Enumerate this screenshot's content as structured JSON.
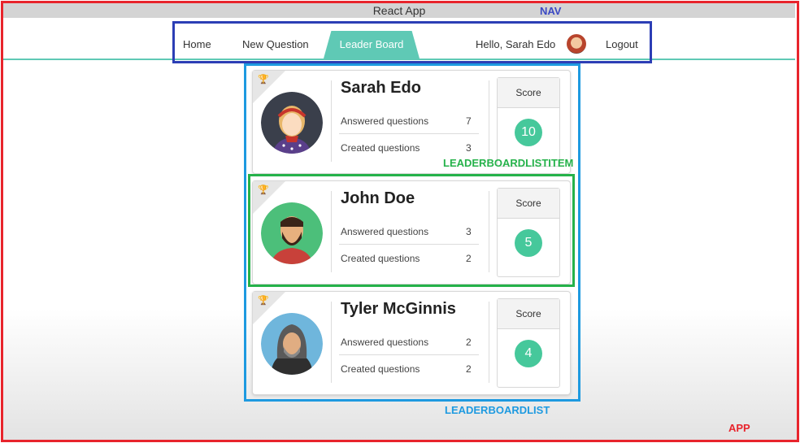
{
  "window": {
    "title": "React App"
  },
  "annotations": {
    "nav": "NAV",
    "item": "LEADERBOARDLISTITEM",
    "list": "LEADERBOARDLIST",
    "app": "APP"
  },
  "nav": {
    "home": "Home",
    "new_question": "New Question",
    "leader_board": "Leader Board",
    "greeting": "Hello, Sarah Edo",
    "logout": "Logout"
  },
  "leaderboard": [
    {
      "name": "Sarah Edo",
      "answered_label": "Answered questions",
      "answered": "7",
      "created_label": "Created questions",
      "created": "3",
      "score_label": "Score",
      "score": "10",
      "trophy_color": "#d9b227"
    },
    {
      "name": "John Doe",
      "answered_label": "Answered questions",
      "answered": "3",
      "created_label": "Created questions",
      "created": "2",
      "score_label": "Score",
      "score": "5",
      "trophy_color": "#3fbf8f"
    },
    {
      "name": "Tyler McGinnis",
      "answered_label": "Answered questions",
      "answered": "2",
      "created_label": "Created questions",
      "created": "2",
      "score_label": "Score",
      "score": "4",
      "trophy_color": "#555555"
    }
  ],
  "colors": {
    "app_border": "#e8242c",
    "nav_border": "#2c3eb5",
    "list_border": "#1e9ae0",
    "item_border": "#25b24a",
    "accent": "#5fc9b5",
    "score": "#46c89b"
  }
}
